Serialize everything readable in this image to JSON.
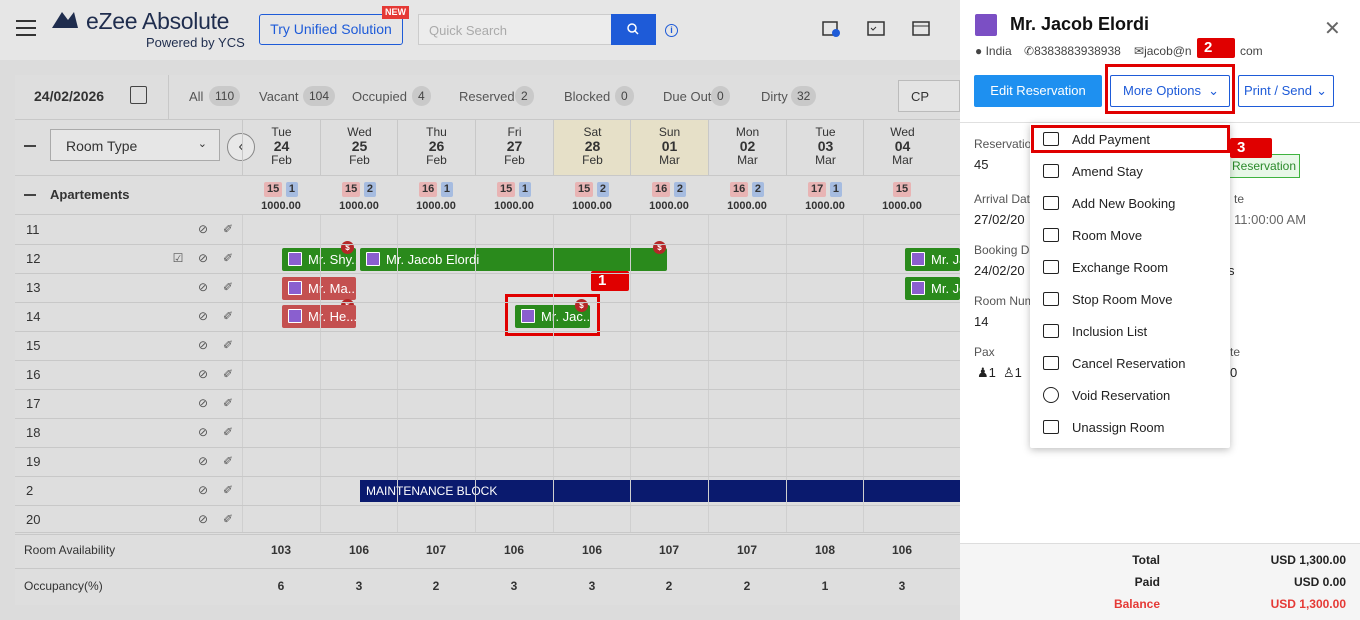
{
  "header": {
    "brand": "eZee Absolute",
    "brand_sub": "Powered by YCS",
    "try_label": "Try Unified Solution",
    "new_badge": "NEW",
    "search_placeholder": "Quick Search"
  },
  "toolbar": {
    "date": "24/02/2026",
    "counts": [
      {
        "label": "All",
        "value": "110"
      },
      {
        "label": "Vacant",
        "value": "104"
      },
      {
        "label": "Occupied",
        "value": "4"
      },
      {
        "label": "Reserved",
        "value": "2"
      },
      {
        "label": "Blocked",
        "value": "0"
      },
      {
        "label": "Due Out",
        "value": "0"
      },
      {
        "label": "Dirty",
        "value": "32"
      }
    ],
    "rate_plan": "CP"
  },
  "grid": {
    "room_type_label": "Room Type",
    "group_name": "Apartements",
    "days": [
      {
        "dow": "Tue",
        "day": "24",
        "mon": "Feb",
        "weekend": false,
        "a": "15",
        "b": "1",
        "rate": "1000.00"
      },
      {
        "dow": "Wed",
        "day": "25",
        "mon": "Feb",
        "weekend": false,
        "a": "15",
        "b": "2",
        "rate": "1000.00"
      },
      {
        "dow": "Thu",
        "day": "26",
        "mon": "Feb",
        "weekend": false,
        "a": "16",
        "b": "1",
        "rate": "1000.00"
      },
      {
        "dow": "Fri",
        "day": "27",
        "mon": "Feb",
        "weekend": false,
        "a": "15",
        "b": "1",
        "rate": "1000.00"
      },
      {
        "dow": "Sat",
        "day": "28",
        "mon": "Feb",
        "weekend": true,
        "a": "15",
        "b": "2",
        "rate": "1000.00"
      },
      {
        "dow": "Sun",
        "day": "01",
        "mon": "Mar",
        "weekend": true,
        "a": "16",
        "b": "2",
        "rate": "1000.00"
      },
      {
        "dow": "Mon",
        "day": "02",
        "mon": "Mar",
        "weekend": false,
        "a": "16",
        "b": "2",
        "rate": "1000.00"
      },
      {
        "dow": "Tue",
        "day": "03",
        "mon": "Mar",
        "weekend": false,
        "a": "17",
        "b": "1",
        "rate": "1000.00"
      },
      {
        "dow": "Wed",
        "day": "04",
        "mon": "Mar",
        "weekend": false,
        "a": "15",
        "b": "",
        "rate": "1000.00"
      }
    ],
    "rooms": [
      "11",
      "12",
      "13",
      "14",
      "15",
      "16",
      "17",
      "18",
      "19",
      "2",
      "20"
    ],
    "bookings": {
      "b1": "Mr. Shy...",
      "b2": "Mr. Jacob Elordi",
      "b3": "Mr. Ma...",
      "b4": "Mr. He...",
      "b5": "Mr. Jac...",
      "b6": "Mr. Ja",
      "b7": "Mr. Jo"
    },
    "maintenance": "MAINTENANCE BLOCK",
    "availability_label": "Room Availability",
    "availability": [
      "103",
      "106",
      "107",
      "106",
      "106",
      "107",
      "107",
      "108",
      "106"
    ],
    "occupancy_label": "Occupancy(%)",
    "occupancy": [
      "6",
      "3",
      "2",
      "3",
      "3",
      "2",
      "2",
      "1",
      "3"
    ]
  },
  "callouts": {
    "one": "1",
    "two": "2",
    "three": "3"
  },
  "panel": {
    "guest_name": "Mr. Jacob Elordi",
    "country": "India",
    "phone": "8383883938938",
    "email": "jacob@n",
    "email_tail": "com",
    "edit_label": "Edit Reservation",
    "more_label": "More Options",
    "print_label": "Print / Send",
    "reservation_lbl": "Reservatio",
    "reservation_val": "45",
    "status": "Reservation",
    "arrival_lbl": "Arrival Dat",
    "arrival_val": "27/02/20",
    "dep_lbl": "te",
    "dep_val": "11:00:00 AM",
    "booking_lbl": "Booking Da",
    "booking_val": "24/02/20",
    "booking_tail": "s",
    "room_lbl": "Room Num",
    "room_val": "14",
    "pax_lbl": "Pax",
    "pax_adult": "1",
    "pax_child": "1",
    "rate_lbl": "te",
    "rate_val": "0",
    "total_lbl": "Total",
    "total_val": "USD 1,300.00",
    "paid_lbl": "Paid",
    "paid_val": "USD 0.00",
    "balance_lbl": "Balance",
    "balance_val": "USD 1,300.00"
  },
  "menu": [
    "Add Payment",
    "Amend Stay",
    "Add New Booking",
    "Room Move",
    "Exchange Room",
    "Stop Room Move",
    "Inclusion List",
    "Cancel Reservation",
    "Void Reservation",
    "Unassign Room"
  ]
}
